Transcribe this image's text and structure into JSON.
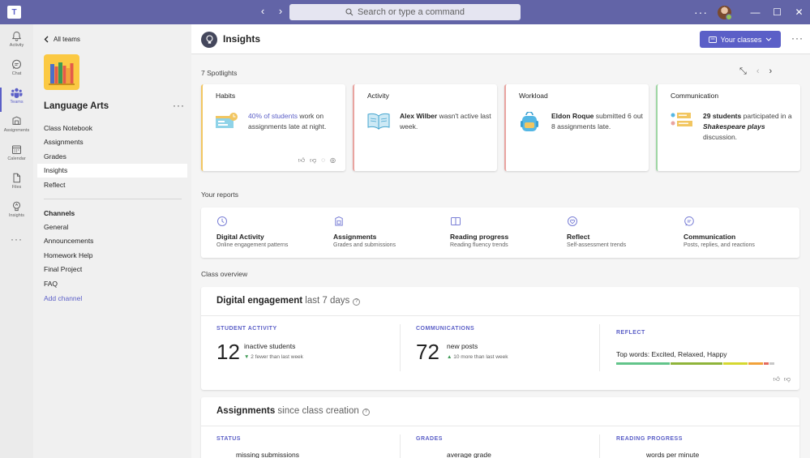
{
  "titlebar": {
    "search_placeholder": "Search or type a command",
    "more": "···"
  },
  "rail": {
    "items": [
      {
        "label": "Activity",
        "icon": "bell-icon"
      },
      {
        "label": "Chat",
        "icon": "chat-icon"
      },
      {
        "label": "Teams",
        "icon": "teams-icon"
      },
      {
        "label": "Assignments",
        "icon": "assignments-icon"
      },
      {
        "label": "Calendar",
        "icon": "calendar-icon"
      },
      {
        "label": "Files",
        "icon": "files-icon"
      },
      {
        "label": "Insights",
        "icon": "insights-icon"
      }
    ],
    "more": "···",
    "active": "Teams"
  },
  "panel": {
    "back_label": "All teams",
    "team_name": "Language Arts",
    "more": "···",
    "menu": [
      "Class Notebook",
      "Assignments",
      "Grades",
      "Insights",
      "Reflect"
    ],
    "active_menu": "Insights",
    "channels_heading": "Channels",
    "channels": [
      "General",
      "Announcements",
      "Homework Help",
      "Final Project",
      "FAQ"
    ],
    "add_channel": "Add channel"
  },
  "header": {
    "title": "Insights",
    "your_classes": "Your classes",
    "more": "···"
  },
  "spotlights": {
    "count_label": "7 Spotlights",
    "cards": [
      {
        "title": "Habits",
        "accent": "#f2c661",
        "highlight": "40% of students",
        "text": " work on assignments late at night.",
        "style": "link"
      },
      {
        "title": "Activity",
        "accent": "#e9a4a0",
        "highlight": "Alex Wilber",
        "text": " wasn't active last week.",
        "style": "bold"
      },
      {
        "title": "Workload",
        "accent": "#e9a4a0",
        "highlight": "Eldon Roque",
        "text": " submitted 6 out 8 assignments late.",
        "style": "bold"
      },
      {
        "title": "Communication",
        "accent": "#9fd6a4",
        "highlight": "29 students",
        "text_a": " participated in a ",
        "emph": "Shakespeare plays",
        "text_b": " discussion."
      }
    ]
  },
  "reports": {
    "heading": "Your reports",
    "items": [
      {
        "title": "Digital Activity",
        "desc": "Online engagement patterns",
        "icon": "clock-icon"
      },
      {
        "title": "Assignments",
        "desc": "Grades and submissions",
        "icon": "clipboard-icon"
      },
      {
        "title": "Reading progress",
        "desc": "Reading fluency trends",
        "icon": "book-icon"
      },
      {
        "title": "Reflect",
        "desc": "Self-assessment trends",
        "icon": "heart-icon"
      },
      {
        "title": "Communication",
        "desc": "Posts, replies, and reactions",
        "icon": "chat-bubble-icon"
      }
    ]
  },
  "overview": {
    "heading": "Class overview",
    "engagement": {
      "title": "Digital engagement",
      "subtitle": "last 7 days",
      "student_activity": {
        "label": "STUDENT ACTIVITY",
        "value": "12",
        "desc": "inactive students",
        "trend": "2 fewer than last week"
      },
      "communications": {
        "label": "COMMUNICATIONS",
        "value": "72",
        "desc": "new posts",
        "trend": "10 more than last week"
      },
      "reflect": {
        "label": "REFLECT",
        "top_words": "Top words: Excited, Relaxed, Happy",
        "bar_colors": [
          "#62c48a",
          "#8fb43a",
          "#d5d830",
          "#f2a23a",
          "#e36a5e",
          "#c8c8c8"
        ],
        "bar_shares": [
          0.33,
          0.32,
          0.15,
          0.09,
          0.03,
          0.03
        ]
      }
    },
    "assignments": {
      "title": "Assignments",
      "subtitle": "since class creation",
      "status": {
        "label": "STATUS",
        "desc": "missing submissions"
      },
      "grades": {
        "label": "GRADES",
        "desc": "average grade"
      },
      "reading": {
        "label": "READING PROGRESS",
        "desc": "words per minute"
      }
    }
  }
}
